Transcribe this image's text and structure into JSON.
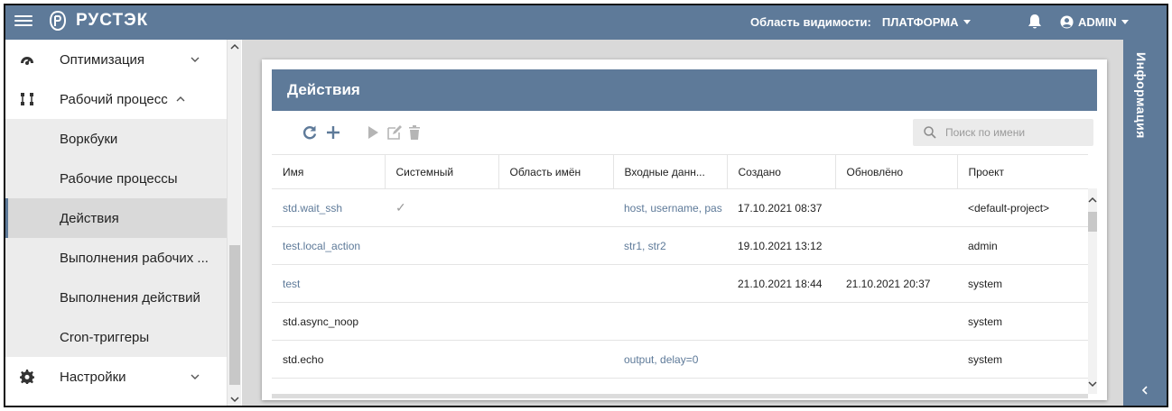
{
  "app": {
    "brand": "РУСТЭК",
    "scope_label": "Область видимости:",
    "scope_value": "ПЛАТФОРМА",
    "user": "ADMIN",
    "colors": {
      "primary": "#5e7a99",
      "sidebar_active": "#d9d9d9"
    }
  },
  "sidebar": {
    "items": [
      {
        "label": "Оптимизация",
        "icon": "dashboard-gauge-icon",
        "expanded": false
      },
      {
        "label": "Рабочий процесс",
        "icon": "workflow-nodes-icon",
        "expanded": true
      },
      {
        "label": "Воркбуки"
      },
      {
        "label": "Рабочие процессы"
      },
      {
        "label": "Действия",
        "active": true
      },
      {
        "label": "Выполнения рабочих ..."
      },
      {
        "label": "Выполнения действий"
      },
      {
        "label": "Cron-триггеры"
      },
      {
        "label": "Настройки",
        "icon": "gear-icon",
        "expanded": false
      }
    ]
  },
  "main": {
    "title": "Действия",
    "search_placeholder": "Поиск по имени",
    "toolbar": [
      "refresh-icon",
      "plus-icon",
      "play-icon",
      "edit-icon",
      "trash-icon"
    ],
    "columns": [
      "Имя",
      "Системный",
      "Область имён",
      "Входные данн...",
      "Создано",
      "Обновлёно",
      "Проект"
    ],
    "rows": [
      {
        "name": "std.wait_ssh",
        "system": "✓",
        "namespace": "",
        "input": "host, username, pas",
        "created": "17.10.2021 08:37",
        "updated": "",
        "project": "<default-project>"
      },
      {
        "name": "test.local_action",
        "system": "",
        "namespace": "",
        "input": "str1, str2",
        "created": "19.10.2021 13:12",
        "updated": "",
        "project": "admin"
      },
      {
        "name": "test",
        "system": "",
        "namespace": "",
        "input": "",
        "created": "21.10.2021 18:44",
        "updated": "21.10.2021 20:37",
        "project": "system"
      },
      {
        "name": "std.async_noop",
        "system": "",
        "namespace": "",
        "input": "",
        "created": "",
        "updated": "",
        "project": "system"
      },
      {
        "name": "std.echo",
        "system": "",
        "namespace": "",
        "input": "output, delay=0",
        "created": "",
        "updated": "",
        "project": "system"
      }
    ]
  },
  "right_panel": {
    "label": "Информация"
  }
}
